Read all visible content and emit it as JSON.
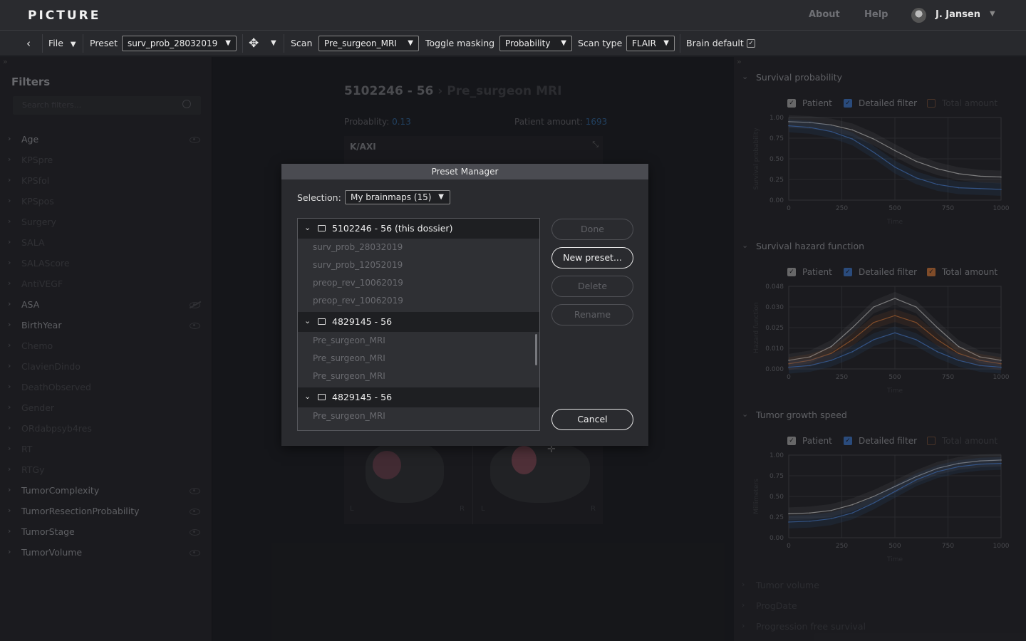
{
  "app": {
    "logo": "PICTURE",
    "nav": {
      "about": "About",
      "help": "Help"
    },
    "user": "J. Jansen"
  },
  "toolbar": {
    "back_icon": "chevron-left-icon",
    "file": "File",
    "preset_label": "Preset",
    "preset_value": "surv_prob_28032019",
    "move_icon": "move-icon",
    "scan_label": "Scan",
    "scan_value": "Pre_surgeon_MRI",
    "toggle_masking_label": "Toggle masking",
    "toggle_masking_value": "Probability",
    "scan_type_label": "Scan type",
    "scan_type_value": "FLAIR",
    "brain_default_label": "Brain default",
    "brain_default_checked": true
  },
  "sidebar": {
    "title": "Filters",
    "search_placeholder": "Search filters...",
    "items": [
      {
        "label": "Age",
        "active": true,
        "eye": "visible"
      },
      {
        "label": "KPSpre",
        "active": false
      },
      {
        "label": "KPSfol",
        "active": false
      },
      {
        "label": "KPSpos",
        "active": false
      },
      {
        "label": "Surgery",
        "active": false
      },
      {
        "label": "SALA",
        "active": false
      },
      {
        "label": "SALAScore",
        "active": false
      },
      {
        "label": "AntiVEGF",
        "active": false
      },
      {
        "label": "ASA",
        "active": true,
        "eye": "hidden"
      },
      {
        "label": "BirthYear",
        "active": true,
        "eye": "visible"
      },
      {
        "label": "Chemo",
        "active": false
      },
      {
        "label": "ClavienDindo",
        "active": false
      },
      {
        "label": "DeathObserved",
        "active": false
      },
      {
        "label": "Gender",
        "active": false
      },
      {
        "label": "ORdabpsyb4res",
        "active": false
      },
      {
        "label": "RT",
        "active": false
      },
      {
        "label": "RTGy",
        "active": false
      },
      {
        "label": "TumorComplexity",
        "active": true,
        "eye": "visible"
      },
      {
        "label": "TumorResectionProbability",
        "active": true,
        "eye": "visible"
      },
      {
        "label": "TumorStage",
        "active": true,
        "eye": "visible"
      },
      {
        "label": "TumorVolume",
        "active": true,
        "eye": "visible"
      }
    ]
  },
  "main": {
    "title": "5102246 - 56",
    "title_sub": "› Pre_surgeon MRI",
    "probability_label": "Probablity:",
    "probability_value": "0.13",
    "patient_amount_label": "Patient amount:",
    "patient_amount_value": "1693",
    "view_label": "K/AXI",
    "left_marker": "L",
    "right_marker": "R"
  },
  "right_panel": {
    "sections": [
      {
        "title": "Survival probability",
        "expanded": true,
        "ylabel": "Survival probability",
        "xlabel": "Time",
        "legend": [
          {
            "label": "Patient",
            "checked": true
          },
          {
            "label": "Detailed filter",
            "checked": true
          },
          {
            "label": "Total amount",
            "checked": false
          }
        ],
        "yticks": [
          "1.00",
          "0.75",
          "0.50",
          "0.25",
          "0.00"
        ],
        "xticks": [
          "0",
          "250",
          "500",
          "750",
          "1000"
        ]
      },
      {
        "title": "Survival hazard function",
        "expanded": true,
        "ylabel": "Hazard function",
        "xlabel": "Time",
        "legend": [
          {
            "label": "Patient",
            "checked": true
          },
          {
            "label": "Detailed filter",
            "checked": true
          },
          {
            "label": "Total amount",
            "checked": true
          }
        ],
        "yticks": [
          "0.048",
          "0.030",
          "0.025",
          "0.010",
          "0.000"
        ],
        "xticks": [
          "0",
          "250",
          "500",
          "750",
          "1000"
        ]
      },
      {
        "title": "Tumor growth speed",
        "expanded": true,
        "ylabel": "Millimeters",
        "xlabel": "Time",
        "legend": [
          {
            "label": "Patient",
            "checked": true
          },
          {
            "label": "Detailed filter",
            "checked": true
          },
          {
            "label": "Total amount",
            "checked": false
          }
        ],
        "yticks": [
          "1.00",
          "0.75",
          "0.50",
          "0.25",
          "0.00"
        ],
        "xticks": [
          "0",
          "250",
          "500",
          "750",
          "1000"
        ]
      }
    ],
    "collapsed_sections": [
      "Tumor volume",
      "ProgDate",
      "Progression free survival"
    ]
  },
  "modal": {
    "title": "Preset Manager",
    "selection_label": "Selection:",
    "selection_value": "My brainmaps (15)",
    "groups": [
      {
        "name": "5102246 - 56 (this dossier)",
        "items": [
          "surv_prob_28032019",
          "surv_prob_12052019",
          "preop_rev_10062019",
          "preop_rev_10062019"
        ]
      },
      {
        "name": "4829145 - 56",
        "items": [
          "Pre_surgeon_MRI",
          "Pre_surgeon_MRI",
          "Pre_surgeon_MRI"
        ]
      },
      {
        "name": "4829145 - 56",
        "items": [
          "Pre_surgeon_MRI"
        ]
      }
    ],
    "buttons": {
      "done": "Done",
      "new_preset": "New preset...",
      "delete": "Delete",
      "rename": "Rename",
      "cancel": "Cancel"
    }
  },
  "colors": {
    "patient": "#c8c8c8",
    "detailed_filter": "#3d6fb8",
    "total_amount": "#c0703a",
    "accent_link": "#2e5f8e"
  },
  "chart_data": [
    {
      "type": "line",
      "title": "Survival probability",
      "xlabel": "Time",
      "ylabel": "Survival probability",
      "xlim": [
        0,
        1000
      ],
      "ylim": [
        0,
        1
      ],
      "x": [
        0,
        100,
        200,
        300,
        400,
        500,
        600,
        700,
        800,
        900,
        1000
      ],
      "series": [
        {
          "name": "Patient",
          "values": [
            0.95,
            0.94,
            0.91,
            0.85,
            0.74,
            0.6,
            0.47,
            0.38,
            0.32,
            0.29,
            0.28
          ]
        },
        {
          "name": "Detailed filter",
          "values": [
            0.9,
            0.88,
            0.83,
            0.74,
            0.58,
            0.4,
            0.27,
            0.19,
            0.15,
            0.14,
            0.13
          ]
        }
      ]
    },
    {
      "type": "line",
      "title": "Survival hazard function",
      "xlabel": "Time",
      "ylabel": "Hazard function",
      "xlim": [
        0,
        1000
      ],
      "x": [
        0,
        100,
        200,
        300,
        400,
        500,
        600,
        700,
        800,
        900,
        1000
      ],
      "series": [
        {
          "name": "Patient",
          "values": [
            0.005,
            0.007,
            0.013,
            0.024,
            0.036,
            0.041,
            0.036,
            0.024,
            0.013,
            0.007,
            0.005
          ]
        },
        {
          "name": "Total amount",
          "values": [
            0.003,
            0.005,
            0.009,
            0.017,
            0.027,
            0.031,
            0.027,
            0.017,
            0.009,
            0.005,
            0.003
          ]
        },
        {
          "name": "Detailed filter",
          "values": [
            0.001,
            0.002,
            0.005,
            0.01,
            0.017,
            0.021,
            0.017,
            0.01,
            0.005,
            0.002,
            0.001
          ]
        }
      ]
    },
    {
      "type": "line",
      "title": "Tumor growth speed",
      "xlabel": "Time",
      "ylabel": "Millimeters",
      "xlim": [
        0,
        1000
      ],
      "ylim": [
        0,
        1
      ],
      "x": [
        0,
        100,
        200,
        300,
        400,
        500,
        600,
        700,
        800,
        900,
        1000
      ],
      "series": [
        {
          "name": "Patient",
          "values": [
            0.29,
            0.3,
            0.33,
            0.4,
            0.5,
            0.62,
            0.74,
            0.84,
            0.9,
            0.93,
            0.94
          ]
        },
        {
          "name": "Detailed filter",
          "values": [
            0.19,
            0.2,
            0.23,
            0.3,
            0.42,
            0.56,
            0.7,
            0.8,
            0.86,
            0.89,
            0.9
          ]
        }
      ]
    }
  ]
}
